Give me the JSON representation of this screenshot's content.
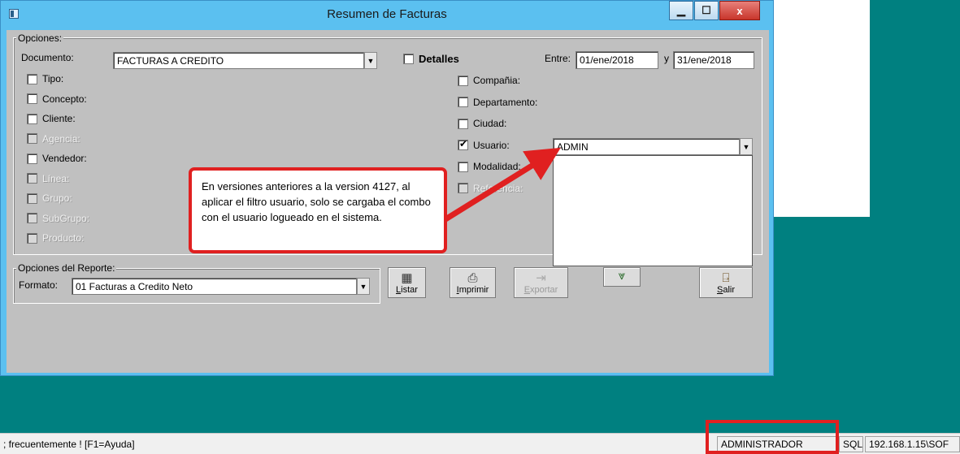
{
  "window": {
    "title": "Resumen de Facturas",
    "minimize": "▁",
    "maximize": "☐",
    "close": "x"
  },
  "opciones": {
    "legend": "Opciones:",
    "documento_label": "Documento:",
    "documento_value": "FACTURAS A CREDITO",
    "detalles_label": "Detalles",
    "entre_label": "Entre:",
    "fecha_desde": "01/ene/2018",
    "y_label": "y",
    "fecha_hasta": "31/ene/2018",
    "left_filters": [
      {
        "label": "Tipo:",
        "disabled": false
      },
      {
        "label": "Concepto:",
        "disabled": false
      },
      {
        "label": "Cliente:",
        "disabled": false
      },
      {
        "label": "Agencia:",
        "disabled": true
      },
      {
        "label": "Vendedor:",
        "disabled": false
      },
      {
        "label": "Línea:",
        "disabled": true
      },
      {
        "label": "Grupo:",
        "disabled": true
      },
      {
        "label": "SubGrupo:",
        "disabled": true
      },
      {
        "label": "Producto:",
        "disabled": true
      }
    ],
    "right_filters": [
      {
        "label": "Compañia:",
        "checked": false,
        "disabled": false
      },
      {
        "label": "Departamento:",
        "checked": false,
        "disabled": false
      },
      {
        "label": "Ciudad:",
        "checked": false,
        "disabled": false
      },
      {
        "label": "Usuario:",
        "checked": true,
        "disabled": false
      },
      {
        "label": "Modalidad:",
        "checked": false,
        "disabled": false
      },
      {
        "label": "Referencia:",
        "checked": false,
        "disabled": true
      }
    ],
    "usuario_value": "ADMIN"
  },
  "reporte": {
    "legend": "Opciones del Reporte:",
    "formato_label": "Formato:",
    "formato_value": "01  Facturas a Credito Neto"
  },
  "buttons": {
    "listar": {
      "prefix": "L",
      "rest": "istar"
    },
    "imprimir": {
      "prefix": "I",
      "rest": "mprimir"
    },
    "exportar": {
      "prefix": "E",
      "rest": "xportar"
    },
    "salir": {
      "prefix": "S",
      "rest": "alir"
    }
  },
  "callout": {
    "text": "En versiones anteriores a la version 4127, al aplicar el filtro usuario, solo se cargaba el combo con el usuario logueado en el sistema."
  },
  "statusbar": {
    "hint": "; frecuentemente !   [F1=Ayuda]",
    "user": "ADMINISTRADOR",
    "db": "SQL",
    "server": "192.168.1.15\\SOF"
  },
  "colors": {
    "accent_red": "#e02020",
    "desktop": "#008080",
    "titlebar": "#5bc0f0"
  }
}
